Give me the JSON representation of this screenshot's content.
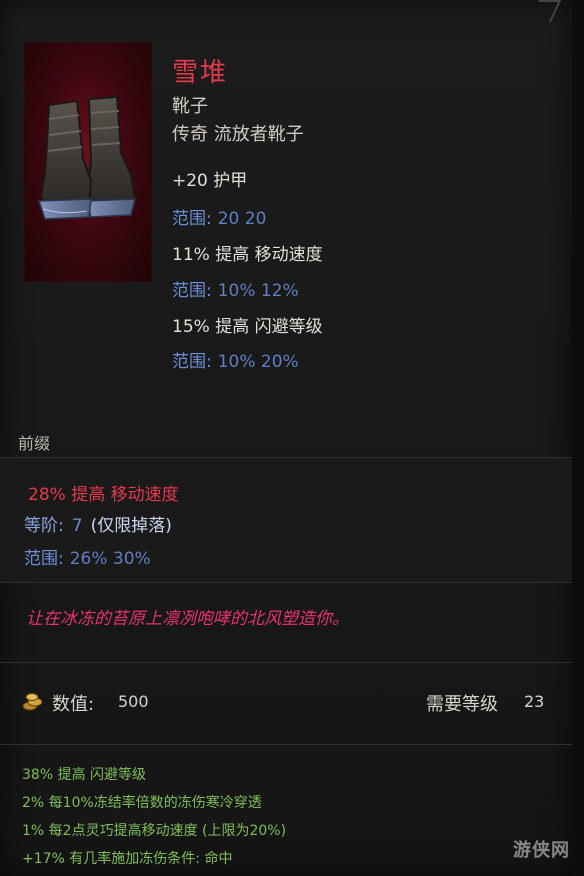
{
  "item": {
    "name": "雪堆",
    "type": "靴子",
    "rarity": "传奇 流放者靴子",
    "stats": [
      {
        "text": "+20 护甲",
        "range_label": "范围:",
        "range_values": "20  20"
      },
      {
        "text": "11% 提高 移动速度",
        "range_label": "范围:",
        "range_values": "10%  12%"
      },
      {
        "text": "15% 提高 闪避等级",
        "range_label": "范围:",
        "range_values": "10%  20%"
      }
    ]
  },
  "prefix": {
    "section_label": "前缀",
    "affix": "28% 提高 移动速度",
    "tier_label": "等阶:",
    "tier_value": "7",
    "tier_note": "(仅限掉落)",
    "range_label": "范围:",
    "range_values": "26%  30%"
  },
  "flavor_text": "让在冰冻的苔原上凛冽咆哮的北风塑造你。",
  "footer": {
    "value_label": "数值:",
    "value": "500",
    "level_label": "需要等级",
    "level": "23"
  },
  "implicits": [
    "38% 提高 闪避等级",
    "2% 每10%冻结率倍数的冻伤寒冷穿透",
    "1% 每2点灵巧提高移动速度 (上限为20%)",
    "+17% 有几率施加冻伤条件: 命中"
  ],
  "watermark": "游侠网",
  "colors": {
    "title": "#e23a4c",
    "range": "#6c8fd6",
    "flavor": "#e8336b",
    "implicit": "#7fbf5a"
  },
  "icons": [
    "boots-icon",
    "coin-icon"
  ]
}
